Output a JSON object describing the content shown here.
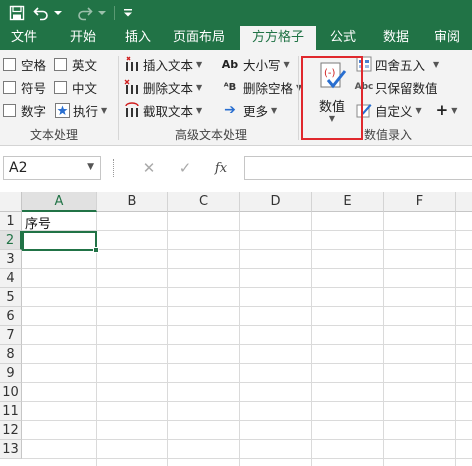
{
  "ribbon_tabs": [
    {
      "label": "文件",
      "active": false
    },
    {
      "label": "开始",
      "active": false
    },
    {
      "label": "插入",
      "active": false
    },
    {
      "label": "页面布局",
      "active": false
    },
    {
      "label": "方方格子",
      "active": true
    },
    {
      "label": "公式",
      "active": false
    },
    {
      "label": "数据",
      "active": false
    },
    {
      "label": "审阅",
      "active": false
    }
  ],
  "text_group": {
    "label": "文本处理",
    "checkboxes": [
      "空格",
      "英文",
      "符号",
      "中文",
      "数字"
    ],
    "exec_label": "执行"
  },
  "adv_group": {
    "label": "高级文本处理",
    "insert_text": "插入文本",
    "delete_text": "删除文本",
    "extract_text": "截取文本",
    "case": "大小写",
    "delete_space": "删除空格",
    "more": "更多"
  },
  "value_group": {
    "label": "数值录入",
    "big_button": "数值",
    "round": "四舍五入",
    "keep_value": "只保留数值",
    "custom": "自定义"
  },
  "formula_bar": {
    "name_box": "A2",
    "fx_label": "fx"
  },
  "grid": {
    "columns": [
      "A",
      "B",
      "C",
      "D",
      "E",
      "F"
    ],
    "rows": [
      "1",
      "2",
      "3",
      "4",
      "5",
      "6",
      "7",
      "8",
      "9",
      "10",
      "11",
      "12",
      "13"
    ],
    "cells": {
      "A1": "序号"
    },
    "active_cell": "A2"
  },
  "colors": {
    "accent": "#217346",
    "highlight": "#e0282d"
  }
}
